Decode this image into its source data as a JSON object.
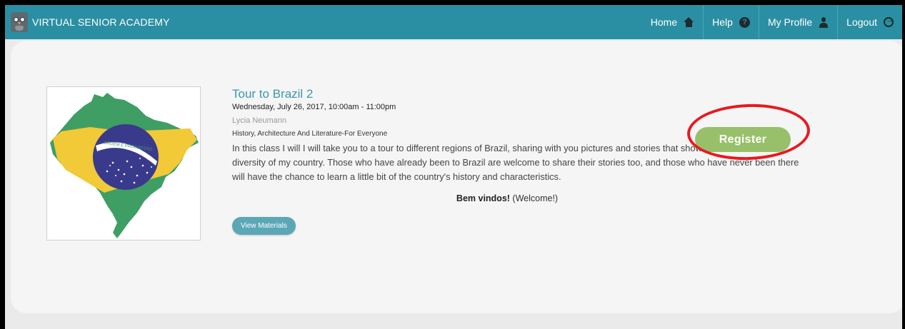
{
  "header": {
    "brand": "VIRTUAL SENIOR ACADEMY",
    "nav": [
      {
        "label": "Home",
        "icon": "home-icon"
      },
      {
        "label": "Help",
        "icon": "help-icon"
      },
      {
        "label": "My Profile",
        "icon": "user-icon"
      },
      {
        "label": "Logout",
        "icon": "logout-icon"
      }
    ],
    "help_glyph": "?"
  },
  "class": {
    "title": "Tour to Brazil 2",
    "date": "Wednesday, July 26, 2017, 10:00am - 11:00pm",
    "teacher": "Lycia Neumann",
    "category": "History, Architecture And Literature-For Everyone",
    "description": "In this class I will I will take you to a tour to different regions of Brazil, sharing with you pictures and stories that show the beauties and diversity of my country. Those who have already been to Brazil are welcome to share their stories too, and those who have never been there will have the chance to learn a little bit of the country's history and characteristics.",
    "welcome_bold": "Bem vindos!",
    "welcome_rest": " (Welcome!)",
    "view_materials": "View Materials",
    "register": "Register",
    "flag_motto": "ORDEM E PROGRESSO"
  },
  "colors": {
    "navbar": "#2b8fa3",
    "title": "#3b97ac",
    "register": "#98c06a",
    "highlight_ring": "#e8191f",
    "map_green": "#3e9e64",
    "map_yellow": "#f2c937",
    "map_blue": "#3a3a8c"
  }
}
